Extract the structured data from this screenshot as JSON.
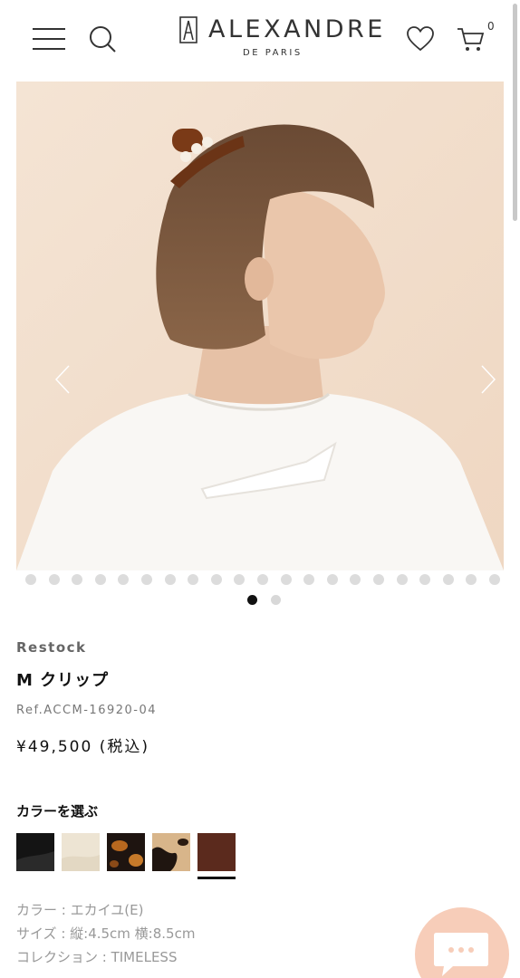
{
  "header": {
    "logo_text": "ALEXANDRE",
    "logo_sub": "DE PARIS",
    "cart_count": "0"
  },
  "carousel": {
    "thumbnail_count": 21,
    "pages": 2,
    "active_page": 1
  },
  "product": {
    "badge": "Restock",
    "name": "M クリップ",
    "ref": "Ref.ACCM-16920-04",
    "price": "¥49,500 (税込)"
  },
  "color_selector": {
    "heading": "カラーを選ぶ",
    "swatches": [
      {
        "name": "black",
        "color": "#1a1a1a"
      },
      {
        "name": "ivory",
        "color": "#ece3d2"
      },
      {
        "name": "dark-tortoise",
        "color": "#2b1d17"
      },
      {
        "name": "light-tortoise",
        "color": "#c99a62"
      },
      {
        "name": "brown",
        "color": "#5a2a1c",
        "selected": true
      }
    ]
  },
  "specs": {
    "color": "カラー : エカイユ(E)",
    "size": "サイズ : 縦:4.5cm 横:8.5cm",
    "collection": "コレクション : TIMELESS"
  },
  "colors": {
    "background": "#ffffff",
    "photo_background": "#f3e2d3",
    "chat_bubble": "#f7cdb9",
    "text_primary": "#111111",
    "text_muted": "#999999"
  }
}
